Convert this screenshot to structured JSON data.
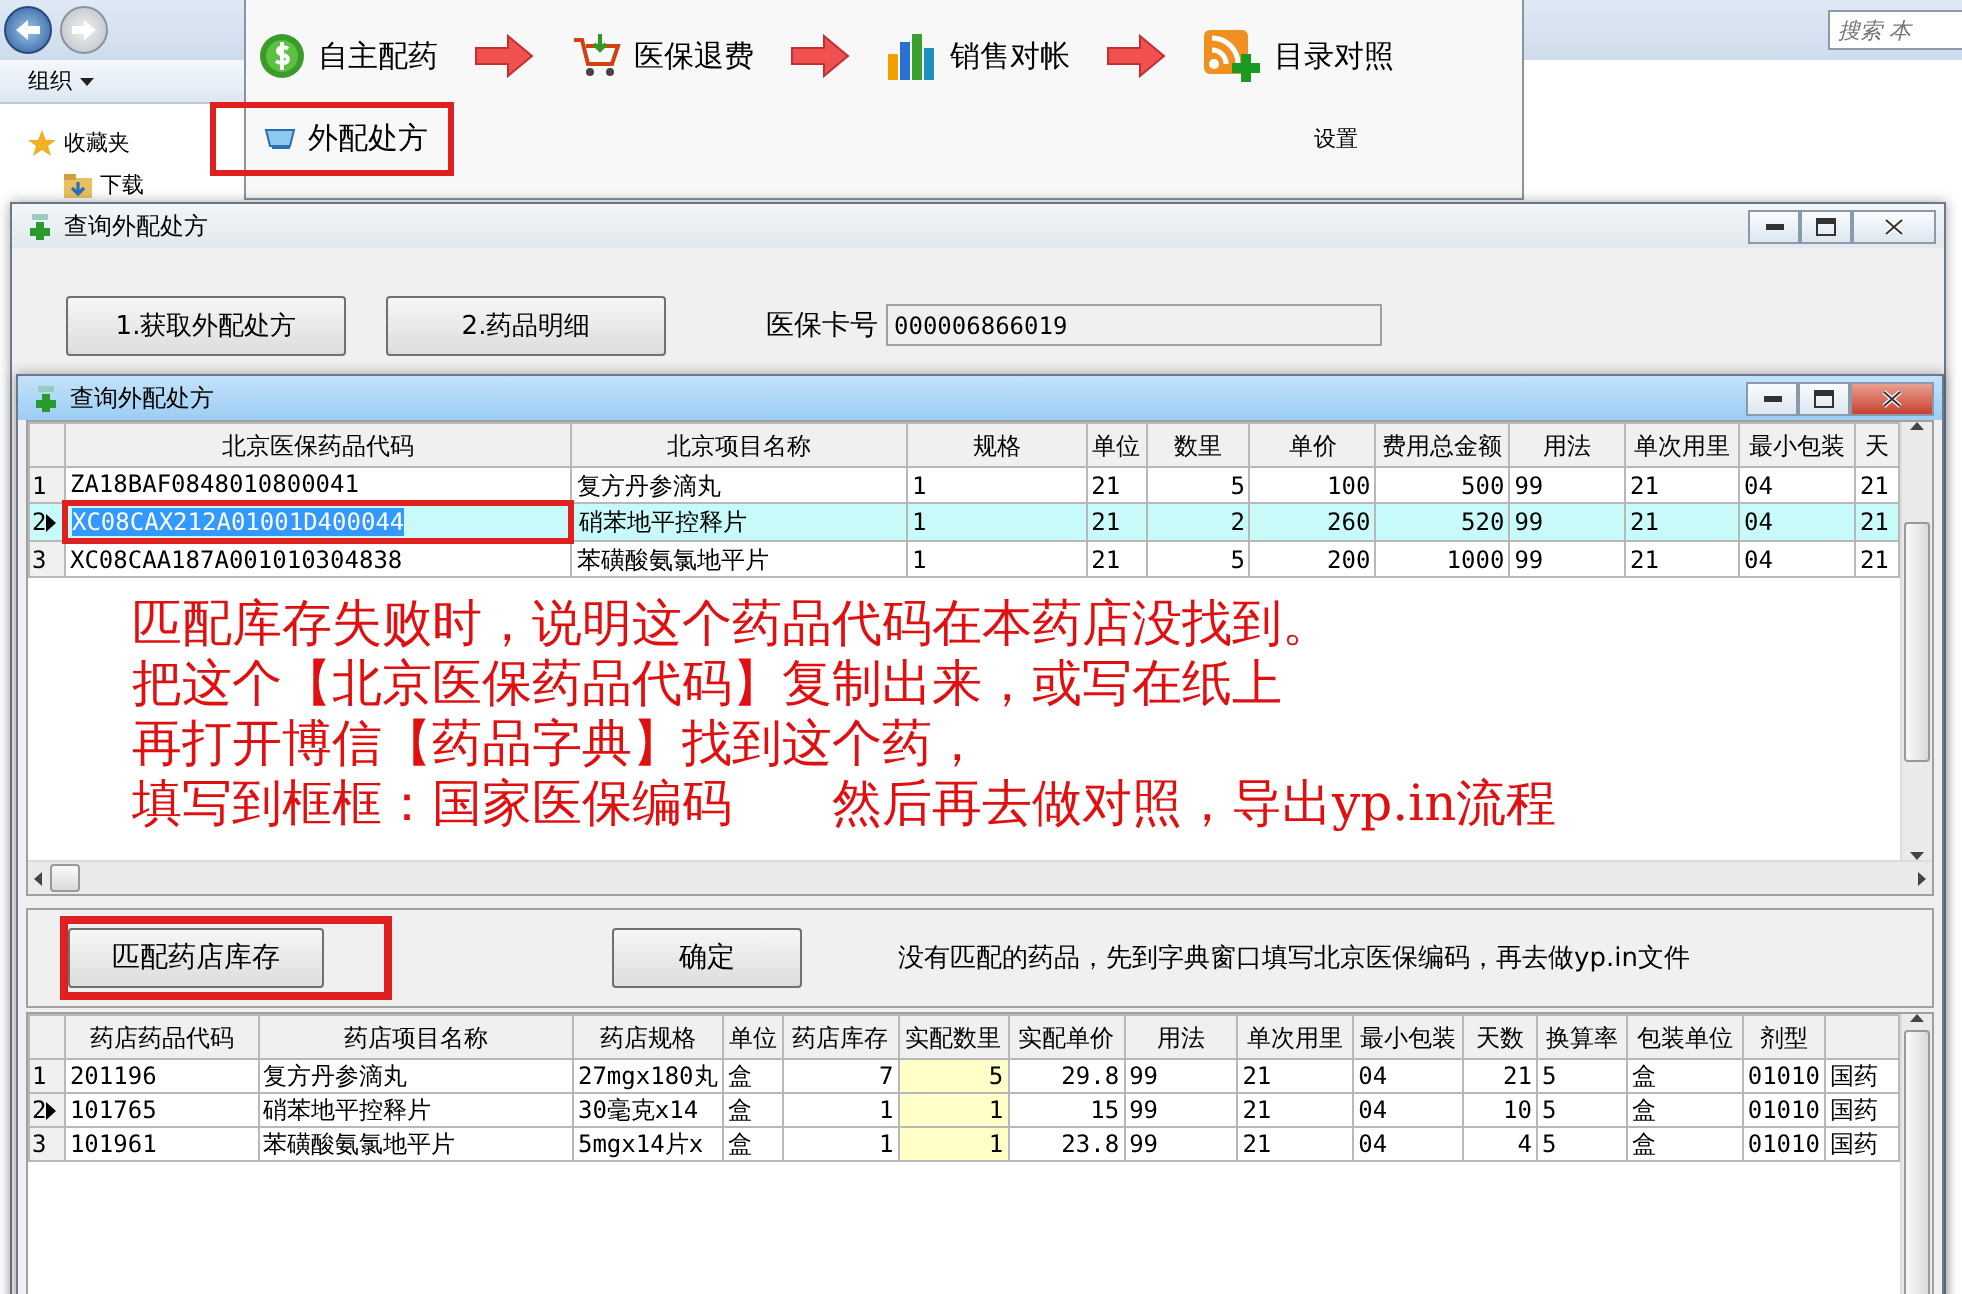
{
  "explorer": {
    "menu": "组织",
    "favorites": "收藏夹",
    "downloads": "下载",
    "search_placeholder": "搜索 本"
  },
  "app_toolbar": {
    "rows": [
      [
        {
          "kind": "money",
          "label": "自主配药"
        },
        {
          "kind": "arrow"
        },
        {
          "kind": "cart",
          "label": "医保退费"
        },
        {
          "kind": "arrow"
        },
        {
          "kind": "chart",
          "label": "销售对帐"
        },
        {
          "kind": "arrow"
        },
        {
          "kind": "rss",
          "label": "目录对照"
        }
      ],
      [
        {
          "kind": "basket",
          "label": "外配处方",
          "highlighted": true
        },
        {
          "kind": "plain",
          "label": "设置",
          "highlighted": false
        }
      ]
    ]
  },
  "query_window": {
    "title": "查询外配处方",
    "buttons": [
      "1.获取外配处方",
      "2.药品明细"
    ],
    "card_label": "医保卡号",
    "card_value": "000006866019"
  },
  "detail_window": {
    "title": "查询外配处方",
    "prescription_table": {
      "row_highlight": true,
      "columns": [
        {
          "label": "北京医保药品代码",
          "kind": "text",
          "editable": false
        },
        {
          "label": "北京项目名称",
          "kind": "text",
          "editable": false
        },
        {
          "label": "规格",
          "kind": "text",
          "editable": false
        },
        {
          "label": "单位",
          "kind": "text",
          "editable": false
        },
        {
          "label": "数里",
          "kind": "number",
          "editable": false
        },
        {
          "label": "单价",
          "kind": "number",
          "editable": false
        },
        {
          "label": "费用总金额",
          "kind": "number",
          "editable": false
        },
        {
          "label": "用法",
          "kind": "text",
          "editable": false
        },
        {
          "label": "单次用里",
          "kind": "text",
          "editable": false
        },
        {
          "label": "最小包装",
          "kind": "text",
          "editable": false
        },
        {
          "label": "天",
          "kind": "text",
          "editable": false
        }
      ],
      "rows": [
        {
          "index": "1",
          "selected": false,
          "highlighted": false,
          "cells": [
            "ZA18BAF0848010800041",
            "复方丹参滴丸",
            "1",
            "21",
            "5",
            "100",
            "500",
            "99",
            "21",
            "04",
            "21"
          ]
        },
        {
          "index": "2",
          "selected": true,
          "highlighted": true,
          "cells": [
            "XC08CAX212A01001D400044",
            "硝苯地平控释片",
            "1",
            "21",
            "2",
            "260",
            "520",
            "99",
            "21",
            "04",
            "21"
          ]
        },
        {
          "index": "3",
          "selected": false,
          "highlighted": false,
          "cells": [
            "XC08CAA187A001010304838",
            "苯磺酸氨氯地平片",
            "1",
            "21",
            "5",
            "200",
            "1000",
            "99",
            "21",
            "04",
            "21"
          ]
        }
      ]
    },
    "annotation": [
      "匹配库存失败时，说明这个药品代码在本药店没找到。",
      "把这个【北京医保药品代码】复制出来，或写在纸上",
      "再打开博信【药品字典】找到这个药，",
      "填写到框框：国家医保编码　　然后再去做对照，导出yp.in流程"
    ],
    "match_button": {
      "label": "匹配药店库存",
      "highlighted": true
    },
    "confirm_button": "确定",
    "hint": "没有匹配的药品，先到字典窗口填写北京医保编码，再去做yp.in文件",
    "stock_table": {
      "row_highlight": false,
      "columns": [
        {
          "label": "药店药品代码",
          "kind": "text",
          "editable": false
        },
        {
          "label": "药店项目名称",
          "kind": "text",
          "editable": false
        },
        {
          "label": "药店规格",
          "kind": "text",
          "editable": false
        },
        {
          "label": "单位",
          "kind": "text",
          "editable": false
        },
        {
          "label": "药店库存",
          "kind": "number",
          "editable": false
        },
        {
          "label": "实配数里",
          "kind": "number",
          "editable": true
        },
        {
          "label": "实配单价",
          "kind": "number",
          "editable": false
        },
        {
          "label": "用法",
          "kind": "text",
          "editable": false
        },
        {
          "label": "单次用里",
          "kind": "text",
          "editable": false
        },
        {
          "label": "最小包装",
          "kind": "text",
          "editable": false
        },
        {
          "label": "天数",
          "kind": "number",
          "editable": false
        },
        {
          "label": "换算率",
          "kind": "text",
          "editable": false
        },
        {
          "label": "包装单位",
          "kind": "text",
          "editable": false
        },
        {
          "label": "剂型",
          "kind": "text",
          "editable": false
        },
        {
          "kind": "text",
          "editable": false
        }
      ],
      "rows": [
        {
          "index": "1",
          "selected": false,
          "highlighted": false,
          "cells": [
            "201196",
            "复方丹参滴丸",
            "27mgx180丸",
            "盒",
            "7",
            "5",
            "29.8",
            "99",
            "21",
            "04",
            "21",
            "5",
            "盒",
            "01010",
            "国药"
          ]
        },
        {
          "index": "2",
          "selected": true,
          "highlighted": false,
          "cells": [
            "101765",
            "硝苯地平控释片",
            "30毫克x14",
            "盒",
            "1",
            "1",
            "15",
            "99",
            "21",
            "04",
            "10",
            "5",
            "盒",
            "01010",
            "国药"
          ]
        },
        {
          "index": "3",
          "selected": false,
          "highlighted": false,
          "cells": [
            "101961",
            "苯磺酸氨氯地平片",
            "5mgx14片x",
            "盒",
            "1",
            "1",
            "23.8",
            "99",
            "21",
            "04",
            "4",
            "5",
            "盒",
            "01010",
            "国药"
          ]
        }
      ]
    }
  }
}
